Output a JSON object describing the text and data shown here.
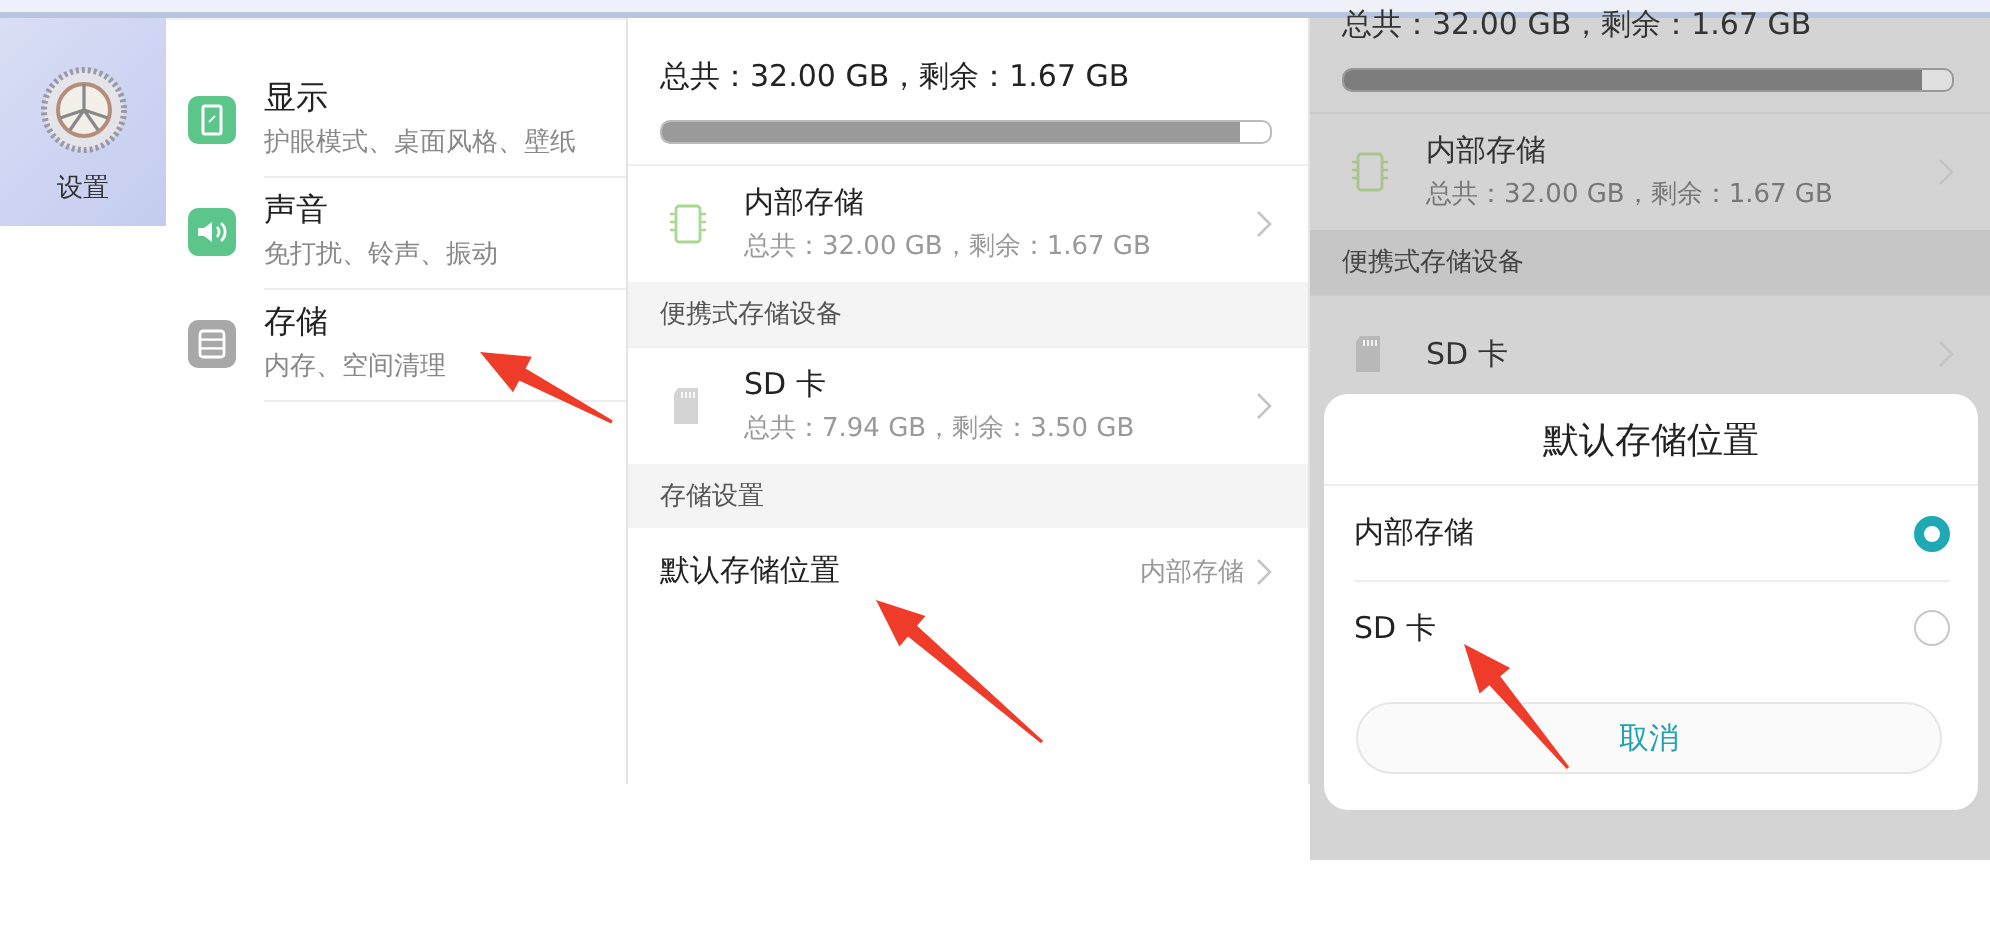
{
  "app_tile": {
    "label": "设置"
  },
  "settings_menu": [
    {
      "kind": "display",
      "title": "显示",
      "subtitle": "护眼模式、桌面风格、壁纸"
    },
    {
      "kind": "sound",
      "title": "声音",
      "subtitle": "免打扰、铃声、振动"
    },
    {
      "kind": "storage",
      "title": "存储",
      "subtitle": "内存、空间清理"
    }
  ],
  "storage_page": {
    "summary": "总共：32.00 GB，剩余：1.67 GB",
    "usage": {
      "level": 0.95
    },
    "devices": [
      {
        "kind": "chip",
        "title": "内部存储",
        "subtitle": "总共：32.00 GB，剩余：1.67 GB"
      },
      {
        "kind": "header",
        "title": "便携式存储设备"
      },
      {
        "kind": "sdcard",
        "title": "SD 卡",
        "subtitle": "总共：7.94 GB，剩余：3.50 GB"
      },
      {
        "kind": "header",
        "title": "存储设置"
      }
    ],
    "default_location": {
      "label": "默认存储位置",
      "value": "内部存储"
    }
  },
  "dialog_page": {
    "summary": "总共：32.00 GB，剩余：1.67 GB",
    "usage": {
      "level": 0.95
    },
    "devices": [
      {
        "kind": "chip",
        "title": "内部存储",
        "subtitle": "总共：32.00 GB，剩余：1.67 GB"
      },
      {
        "kind": "header",
        "title": "便携式存储设备"
      },
      {
        "kind": "sdcard",
        "title": "SD 卡"
      }
    ],
    "dialog": {
      "title": "默认存储位置",
      "options": [
        {
          "label": "内部存储",
          "selected": true
        },
        {
          "label": "SD 卡",
          "selected": false
        }
      ],
      "cancel": "取消"
    }
  }
}
